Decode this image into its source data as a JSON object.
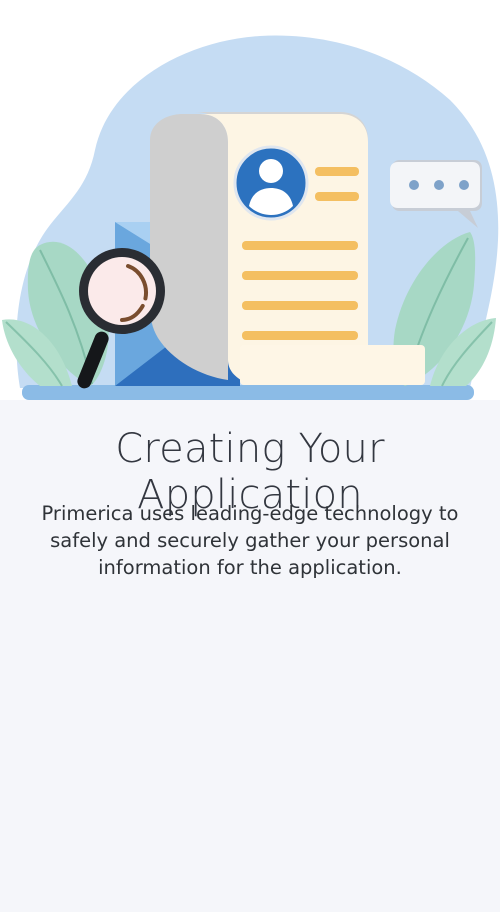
{
  "colors": {
    "background": "#f5f6fa",
    "blob": "#c5dcf3",
    "document": "#fdf5e4",
    "document_fold": "#d4d4d4",
    "bars": "#f4bf61",
    "avatar": "#2c72bf",
    "envelope": "#2e6fbd",
    "leaves": "#a7d8c5",
    "magnifier_rim": "#2a2d33",
    "title_text": "#333740"
  },
  "illustration": {
    "icons": [
      "document-icon",
      "avatar-icon",
      "envelope-icon",
      "magnifier-icon",
      "chat-bubble-icon",
      "leaf-icon"
    ]
  },
  "main": {
    "title": "Creating Your Application",
    "description": "Primerica uses leading-edge technology to safely and securely gather your personal information for the application."
  }
}
